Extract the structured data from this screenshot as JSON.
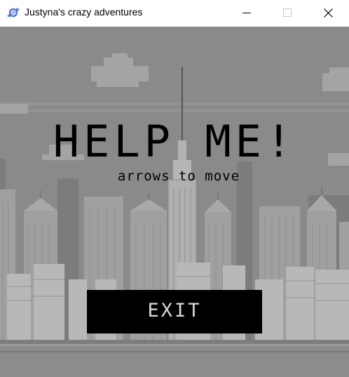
{
  "window": {
    "title": "Justyna's crazy adventures",
    "app_icon": "candy-icon",
    "controls": [
      "minimize-icon",
      "maximize-icon",
      "close-icon"
    ]
  },
  "game": {
    "background": "grayscale pixel-art city skyline",
    "headline": "HELP ME!",
    "instructions": "arrows to move",
    "exit_label": "EXIT"
  },
  "colors": {
    "sky": "#8a8a8a",
    "text": "#000000",
    "button_bg": "#000000",
    "button_text": "#d8d8d8"
  }
}
